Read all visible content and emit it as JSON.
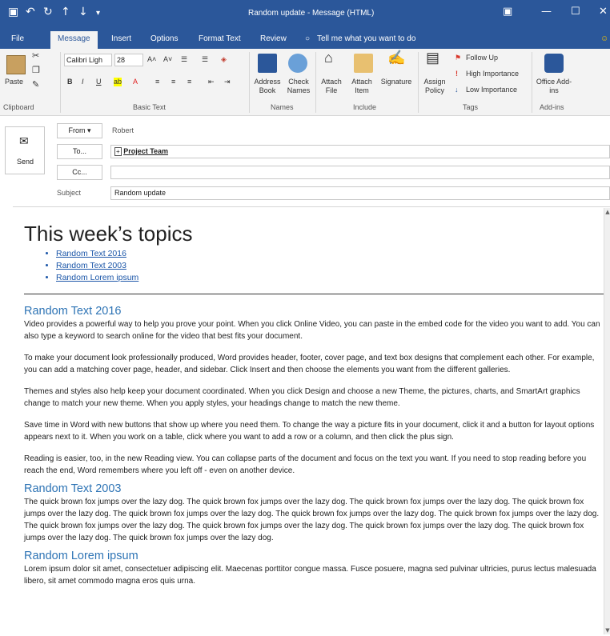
{
  "window": {
    "title": "Random update - Message (HTML)",
    "controls": [
      "▣",
      "—",
      "☐",
      "✕"
    ],
    "quick_access": [
      "save",
      "undo",
      "redo",
      "up",
      "down",
      "customize"
    ]
  },
  "tabs": [
    "File",
    "Message",
    "Insert",
    "Options",
    "Format Text",
    "Review"
  ],
  "active_tab": "Message",
  "tell_me": "Tell me what you want to do",
  "ribbon": {
    "clipboard": {
      "paste": "Paste",
      "label": "Clipboard"
    },
    "basic_text": {
      "font": "Calibri Ligh",
      "size": "28",
      "bold": "B",
      "italic": "I",
      "underline": "U",
      "label": "Basic Text"
    },
    "names": {
      "address_book": "Address Book",
      "check_names": "Check Names",
      "label": "Names"
    },
    "include": {
      "attach_file": "Attach File",
      "attach_item": "Attach Item",
      "signature": "Signature",
      "label": "Include"
    },
    "tags": {
      "assign_policy": "Assign Policy",
      "follow_up": "Follow Up",
      "high": "High Importance",
      "low": "Low Importance",
      "label": "Tags"
    },
    "addins": {
      "office": "Office Add-ins",
      "label": "Add-ins"
    }
  },
  "compose": {
    "send": "Send",
    "from_label": "From",
    "from_value": "Robert",
    "to_label": "To...",
    "to_value": "Project Team",
    "cc_label": "Cc...",
    "cc_value": "",
    "subject_label": "Subject",
    "subject_value": "Random update"
  },
  "body": {
    "heading": "This week’s topics",
    "links": [
      "Random Text 2016",
      "Random Text 2003",
      "Random Lorem ipsum"
    ],
    "sections": [
      {
        "title": "Random Text 2016",
        "paragraphs": [
          "Video provides a powerful way to help you prove your point. When you click Online Video, you can paste in the embed code for the video you want to add. You can also type a keyword to search online for the video that best fits your document.",
          "To make your document look professionally produced, Word provides header, footer, cover page, and text box designs that complement each other. For example, you can add a matching cover page, header, and sidebar. Click Insert and then choose the elements you want from the different galleries.",
          "Themes and styles also help keep your document coordinated. When you click Design and choose a new Theme, the pictures, charts, and SmartArt graphics change to match your new theme. When you apply styles, your headings change to match the new theme.",
          "Save time in Word with new buttons that show up where you need them. To change the way a picture fits in your document, click it and a button for layout options appears next to it. When you work on a table, click where you want to add a row or a column, and then click the plus sign.",
          "Reading is easier, too, in the new Reading view. You can collapse parts of the document and focus on the text you want. If you need to stop reading before you reach the end, Word remembers where you left off - even on another device."
        ]
      },
      {
        "title": "Random Text 2003",
        "paragraphs": [
          "The quick brown fox jumps over the lazy dog. The quick brown fox jumps over the lazy dog. The quick brown fox jumps over the lazy dog. The quick brown fox jumps over the lazy dog. The quick brown fox jumps over the lazy dog. The quick brown fox jumps over the lazy dog. The quick brown fox jumps over the lazy dog. The quick brown fox jumps over the lazy dog. The quick brown fox jumps over the lazy dog. The quick brown fox jumps over the lazy dog. The quick brown fox jumps over the lazy dog. The quick brown fox jumps over the lazy dog."
        ]
      },
      {
        "title": "Random Lorem ipsum",
        "paragraphs": [
          "Lorem ipsum dolor sit amet, consectetuer adipiscing elit. Maecenas porttitor congue massa. Fusce posuere, magna sed pulvinar ultricies, purus lectus malesuada libero, sit amet commodo magna eros quis urna."
        ]
      }
    ]
  },
  "colors": {
    "brand": "#2b579a",
    "link": "#1b56a8",
    "heading": "#2e74b5"
  }
}
